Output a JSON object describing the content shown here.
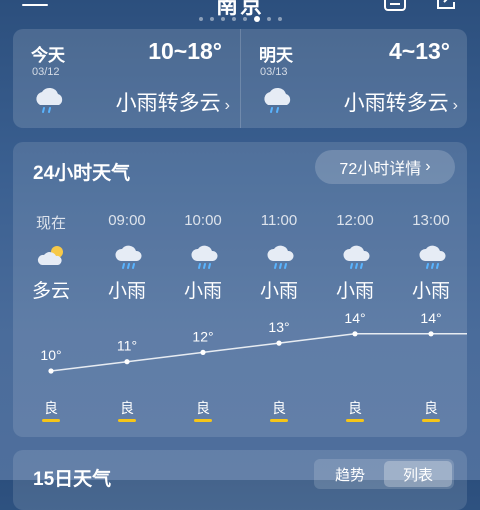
{
  "header": {
    "city": "南京",
    "page_dots": 8,
    "active_dot": 5,
    "icons": [
      "menu-icon",
      "calendar-icon",
      "share-icon"
    ]
  },
  "days": [
    {
      "label": "今天",
      "date": "03/12",
      "temp": "10~18°",
      "condition": "小雨转多云",
      "chevron": "›",
      "icon": "rain-cloud-icon"
    },
    {
      "label": "明天",
      "date": "03/13",
      "temp": "4~13°",
      "condition": "小雨转多云",
      "chevron": "›",
      "icon": "rain-cloud-icon"
    }
  ],
  "hourly": {
    "title": "24小时天气",
    "detail_button": "72小时详情",
    "detail_chevron": "›",
    "hours": [
      {
        "time": "现在",
        "condition": "多云",
        "temp": "10°",
        "aqi": "良",
        "icon": "partly-cloudy-icon"
      },
      {
        "time": "09:00",
        "condition": "小雨",
        "temp": "11°",
        "aqi": "良",
        "icon": "rain-cloud-icon"
      },
      {
        "time": "10:00",
        "condition": "小雨",
        "temp": "12°",
        "aqi": "良",
        "icon": "rain-cloud-icon"
      },
      {
        "time": "11:00",
        "condition": "小雨",
        "temp": "13°",
        "aqi": "良",
        "icon": "rain-cloud-icon"
      },
      {
        "time": "12:00",
        "condition": "小雨",
        "temp": "14°",
        "aqi": "良",
        "icon": "rain-cloud-icon"
      },
      {
        "time": "13:00",
        "condition": "小雨",
        "temp": "14°",
        "aqi": "良",
        "icon": "rain-cloud-icon"
      }
    ],
    "temperatures": [
      10,
      11,
      12,
      13,
      14,
      14
    ],
    "aqi_color": "#f5c518"
  },
  "forecast15": {
    "title": "15日天气",
    "tabs": [
      "趋势",
      "列表"
    ],
    "selected_tab": "列表"
  }
}
